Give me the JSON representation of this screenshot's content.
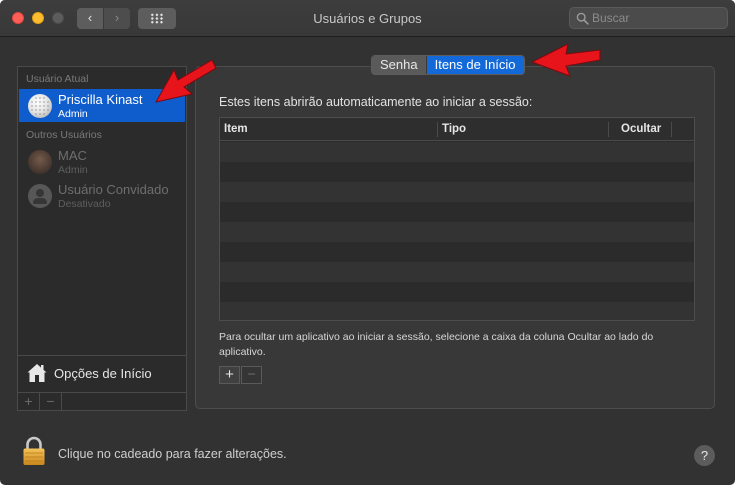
{
  "window": {
    "title": "Usuários e Grupos"
  },
  "toolbar": {
    "back_icon": "‹",
    "forward_icon": "›",
    "search_placeholder": "Buscar"
  },
  "sidebar": {
    "current_user_label": "Usuário Atual",
    "current_user": {
      "name": "Priscilla Kinast",
      "role": "Admin",
      "avatar": "golf-ball"
    },
    "other_users_label": "Outros Usuários",
    "other_users": [
      {
        "name": "MAC",
        "role": "Admin",
        "avatar": "photo"
      },
      {
        "name": "Usuário Convidado",
        "role": "Desativado",
        "avatar": "guest-silhouette"
      }
    ],
    "login_options_label": "Opções de Início",
    "add_label": "+",
    "remove_label": "−"
  },
  "tabs": [
    {
      "label": "Senha",
      "selected": false
    },
    {
      "label": "Itens de Início",
      "selected": true
    }
  ],
  "login_items": {
    "intro": "Estes itens abrirão automaticamente ao iniciar a sessão:",
    "columns": [
      "Item",
      "Tipo",
      "Ocultar"
    ],
    "rows": [],
    "hint": "Para ocultar um aplicativo ao iniciar a sessão, selecione a caixa da coluna Ocultar ao lado do aplicativo.",
    "add_label": "+",
    "remove_label": "−"
  },
  "footer": {
    "lock_text": "Clique no cadeado para fazer alterações.",
    "help_label": "?"
  },
  "colors": {
    "selection": "#0f5ccd",
    "tab_selected": "#1469d9",
    "annotation_arrow": "#e8141c"
  }
}
